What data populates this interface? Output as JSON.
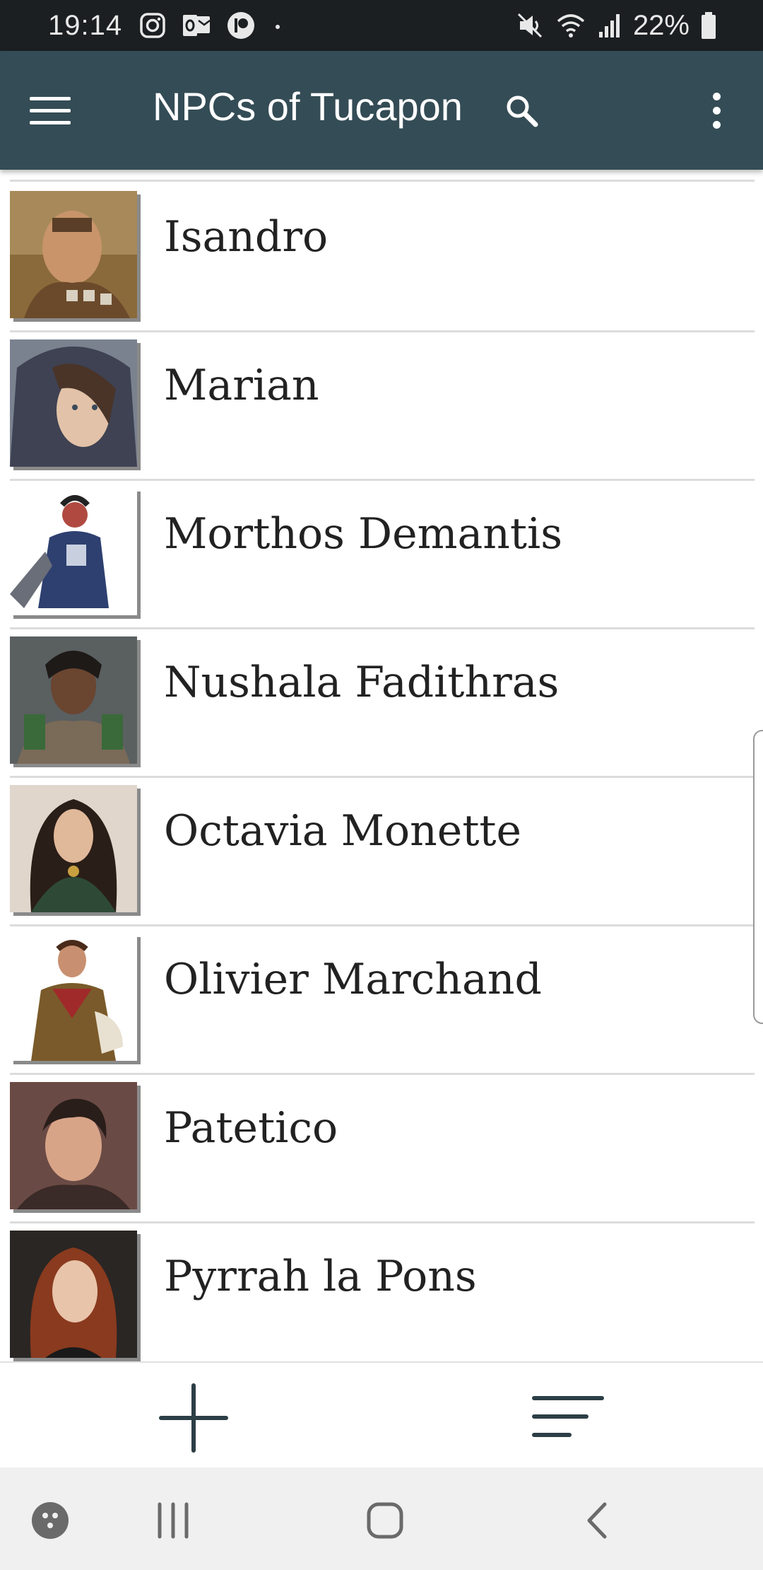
{
  "status_bar": {
    "time": "19:14",
    "battery": "22%",
    "icons_left": [
      "instagram-icon",
      "outlook-icon",
      "patreon-icon",
      "dot-icon"
    ],
    "icons_right": [
      "mute-icon",
      "wifi-icon",
      "signal-icon",
      "battery-icon"
    ]
  },
  "app_bar": {
    "title": "NPCs of Tucapon",
    "color": "#344c55"
  },
  "npcs": [
    {
      "name": "Isandro",
      "portrait": "portrait-isandro"
    },
    {
      "name": "Marian",
      "portrait": "portrait-marian"
    },
    {
      "name": "Morthos Demantis",
      "portrait": "portrait-morthos"
    },
    {
      "name": "Nushala Fadithras",
      "portrait": "portrait-nushala"
    },
    {
      "name": "Octavia Monette",
      "portrait": "portrait-octavia"
    },
    {
      "name": "Olivier Marchand",
      "portrait": "portrait-olivier"
    },
    {
      "name": "Patetico",
      "portrait": "portrait-patetico"
    },
    {
      "name": "Pyrrah la Pons",
      "portrait": "portrait-pyrrah"
    }
  ],
  "bottom_bar": {
    "icons": [
      "add-icon",
      "sort-icon"
    ]
  },
  "nav_bar": {
    "icons": [
      "game-launcher-icon",
      "recent-apps-icon",
      "home-icon",
      "back-icon"
    ]
  }
}
